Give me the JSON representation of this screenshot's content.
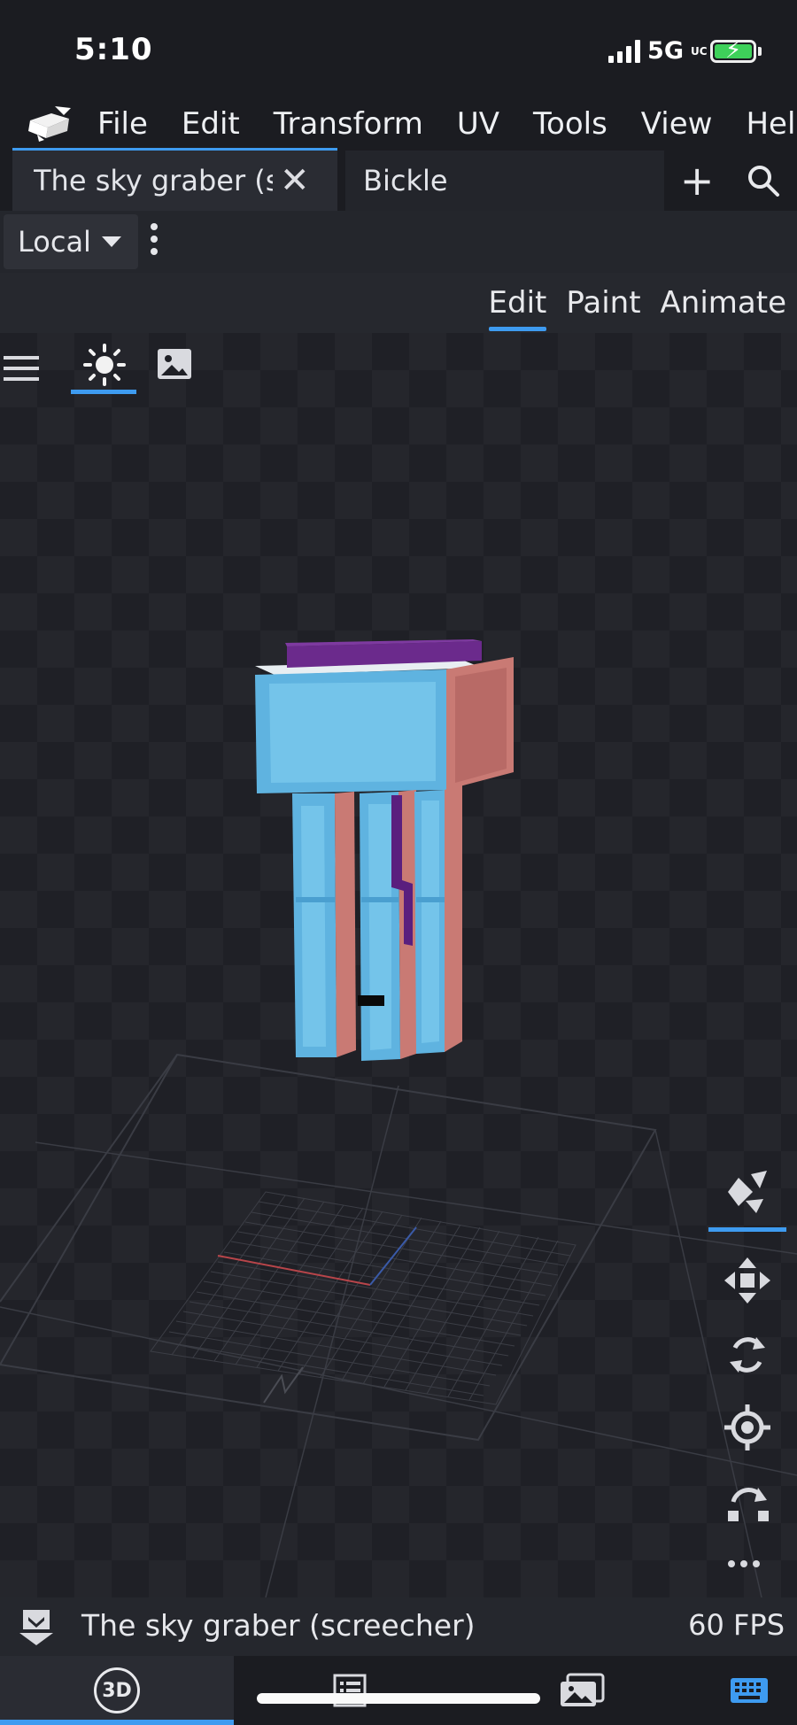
{
  "status": {
    "time": "5:10",
    "network": "5G",
    "network_suffix": "UC"
  },
  "menu": {
    "items": [
      "File",
      "Edit",
      "Transform",
      "UV",
      "Tools",
      "View",
      "Hel"
    ]
  },
  "tabs": {
    "active": {
      "label": "The sky graber (sc"
    },
    "second": {
      "label": "Bickle"
    }
  },
  "toolbar": {
    "space_mode": "Local"
  },
  "modes": {
    "items": [
      "Edit",
      "Paint",
      "Animate"
    ],
    "active": "Edit"
  },
  "viewport": {
    "icons": [
      "hamburger-icon",
      "sun-icon",
      "image-icon"
    ]
  },
  "right_tools": [
    "vertex-snap-icon",
    "move-icon",
    "rotate-icon",
    "pivot-icon",
    "resize-icon",
    "more-icon"
  ],
  "bottom": {
    "project_name": "The sky graber (screecher)",
    "fps": "60 FPS"
  },
  "dock": {
    "view_label": "3D",
    "icons": [
      "outliner-icon",
      "textures-icon",
      "keyboard-icon"
    ]
  },
  "colors": {
    "accent": "#3e9bf0",
    "model_body": "#5fb3e0",
    "model_side": "#c97a74",
    "model_top": "#6b2a8c"
  }
}
